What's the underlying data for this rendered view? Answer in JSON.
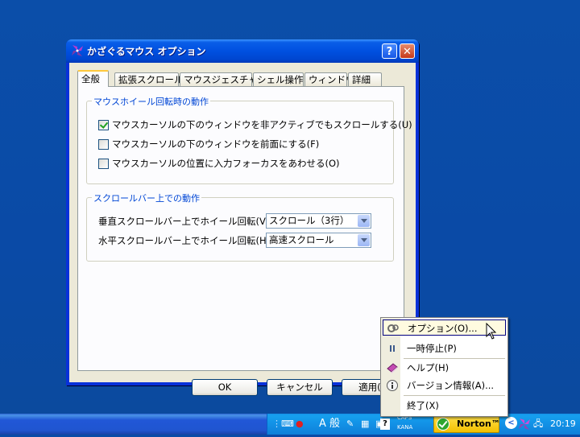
{
  "window": {
    "title": "かざぐるマウス オプション",
    "help_label": "?",
    "close_label": "✕"
  },
  "tabs": [
    {
      "label": "全般",
      "active": true
    },
    {
      "label": "拡張スクロール",
      "active": false
    },
    {
      "label": "マウスジェスチャー",
      "active": false
    },
    {
      "label": "シェル操作",
      "active": false
    },
    {
      "label": "ウィンドウ",
      "active": false
    },
    {
      "label": "詳細",
      "active": false
    }
  ],
  "group_wheel": {
    "title": "マウスホイール回転時の動作",
    "options": [
      {
        "label": "マウスカーソルの下のウィンドウを非アクティブでもスクロールする(U)",
        "checked": true
      },
      {
        "label": "マウスカーソルの下のウィンドウを前面にする(F)",
        "checked": false
      },
      {
        "label": "マウスカーソルの位置に入力フォーカスをあわせる(O)",
        "checked": false
      }
    ]
  },
  "group_scrollbar": {
    "title": "スクロールバー上での動作",
    "rows": [
      {
        "label": "垂直スクロールバー上でホイール回転(V):",
        "value": "スクロール（3行）"
      },
      {
        "label": "水平スクロールバー上でホイール回転(H):",
        "value": "高速スクロール"
      }
    ]
  },
  "buttons": {
    "ok": "OK",
    "cancel": "キャンセル",
    "apply": "適用(A)"
  },
  "context_menu": {
    "items": [
      {
        "label": "オプション(O)...",
        "icon": "gear-icon",
        "highlighted": true
      },
      {
        "label": "一時停止(P)",
        "icon": "pause-icon",
        "highlighted": false
      },
      {
        "label": "ヘルプ(H)",
        "icon": "book-icon",
        "highlighted": false
      },
      {
        "label": "バージョン情報(A)...",
        "icon": "info-icon",
        "highlighted": false
      },
      {
        "label": "終了(X)",
        "icon": "",
        "highlighted": false
      }
    ]
  },
  "taskbar": {
    "ime_mode": "A 般",
    "caps": "CAPS",
    "kana": "KANA",
    "norton": "Norton™",
    "clock": "20:19"
  },
  "colors": {
    "desktop": "#0a4aa6",
    "titlebar": "#0050e0",
    "group_title": "#0046d5",
    "dialog_bg": "#ece9d8"
  }
}
